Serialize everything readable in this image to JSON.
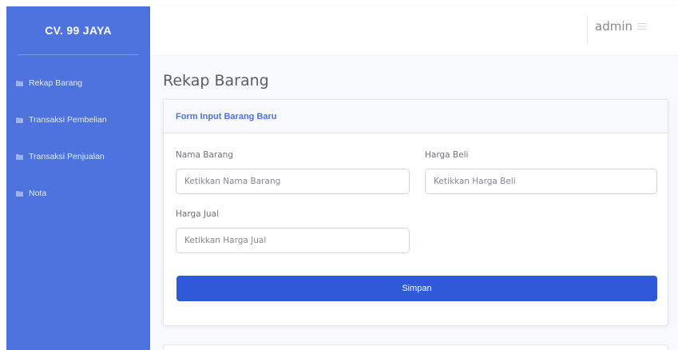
{
  "sidebar": {
    "brand": "CV. 99 JAYA",
    "items": [
      {
        "label": "Rekap Barang",
        "icon": "folder-icon"
      },
      {
        "label": "Transaksi Pembelian",
        "icon": "folder-icon"
      },
      {
        "label": "Transaksi Penjualan",
        "icon": "folder-icon"
      },
      {
        "label": "Nota",
        "icon": "folder-icon"
      }
    ]
  },
  "topbar": {
    "username": "admin",
    "user_icon": "menu-icon"
  },
  "main": {
    "page_title": "Rekap Barang",
    "form": {
      "header": "Form Input Barang Baru",
      "fields": [
        {
          "label": "Nama Barang",
          "placeholder": "Ketikkan Nama Barang",
          "value": ""
        },
        {
          "label": "Harga Beli",
          "placeholder": "Ketikkan Harga Beli",
          "value": ""
        },
        {
          "label": "Harga Jual",
          "placeholder": "Ketikkan Harga Jual",
          "value": ""
        }
      ],
      "submit_label": "Simpan"
    }
  },
  "colors": {
    "sidebar": "#4e73df",
    "primary_button": "#2e59d9",
    "page_background": "#f8f9fc",
    "text_muted": "#858796"
  }
}
